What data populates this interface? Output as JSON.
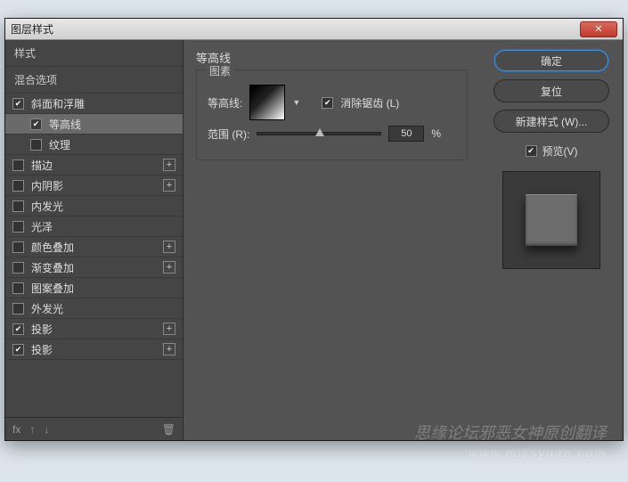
{
  "title": "图层样式",
  "sidebar": {
    "styles_label": "样式",
    "blend_label": "混合选项",
    "items": [
      {
        "label": "斜面和浮雕",
        "checked": true,
        "plus": false,
        "sub": false
      },
      {
        "label": "等高线",
        "checked": true,
        "plus": false,
        "sub": true,
        "selected": true
      },
      {
        "label": "纹理",
        "checked": false,
        "plus": false,
        "sub": true
      },
      {
        "label": "描边",
        "checked": false,
        "plus": true,
        "sub": false
      },
      {
        "label": "内阴影",
        "checked": false,
        "plus": true,
        "sub": false
      },
      {
        "label": "内发光",
        "checked": false,
        "plus": false,
        "sub": false
      },
      {
        "label": "光泽",
        "checked": false,
        "plus": false,
        "sub": false
      },
      {
        "label": "颜色叠加",
        "checked": false,
        "plus": true,
        "sub": false
      },
      {
        "label": "渐变叠加",
        "checked": false,
        "plus": true,
        "sub": false
      },
      {
        "label": "图案叠加",
        "checked": false,
        "plus": false,
        "sub": false
      },
      {
        "label": "外发光",
        "checked": false,
        "plus": false,
        "sub": false
      },
      {
        "label": "投影",
        "checked": true,
        "plus": true,
        "sub": false
      },
      {
        "label": "投影",
        "checked": true,
        "plus": true,
        "sub": false
      }
    ],
    "footer": {
      "fx": "fx",
      "up": "↑",
      "down": "↓",
      "trash": "🗑"
    }
  },
  "center": {
    "panel_title": "等高线",
    "group_label": "图素",
    "contour_label": "等高线:",
    "antialias_label": "消除锯齿 (L)",
    "antialias_checked": true,
    "range_label": "范围 (R):",
    "range_value": "50",
    "range_unit": "%"
  },
  "right": {
    "ok": "确定",
    "reset": "复位",
    "new_style": "新建样式 (W)...",
    "preview_label": "预览(V)",
    "preview_checked": true
  },
  "watermark": {
    "line1": "思缘论坛邪恶女神原创翻译",
    "line2": "www.missyuan.com"
  }
}
